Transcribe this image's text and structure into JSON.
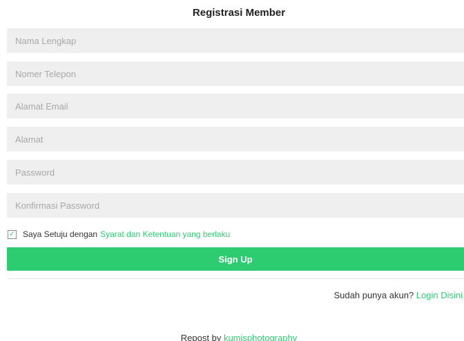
{
  "form": {
    "title": "Registrasi Member",
    "fields": [
      {
        "placeholder": "Nama Lengkap",
        "value": ""
      },
      {
        "placeholder": "Nomer Telepon",
        "value": ""
      },
      {
        "placeholder": "Alamat Email",
        "value": ""
      },
      {
        "placeholder": "Alamat",
        "value": ""
      },
      {
        "placeholder": "Password",
        "value": ""
      },
      {
        "placeholder": "Konfirmasi Password",
        "value": ""
      }
    ],
    "agreement": {
      "checked": true,
      "check_glyph": "✓",
      "text": "Saya Setuju dengan",
      "link_text": "Syarat dan Ketentuan yang berlaku"
    },
    "submit_label": "Sign Up",
    "login_prompt": "Sudah punya akun?",
    "login_link": "Login Disini"
  },
  "footer": {
    "text": "Repost by",
    "link": "kumisphotography"
  },
  "colors": {
    "accent": "#2ecc71",
    "field_bg": "#efefef",
    "placeholder": "#a8a8a8"
  }
}
